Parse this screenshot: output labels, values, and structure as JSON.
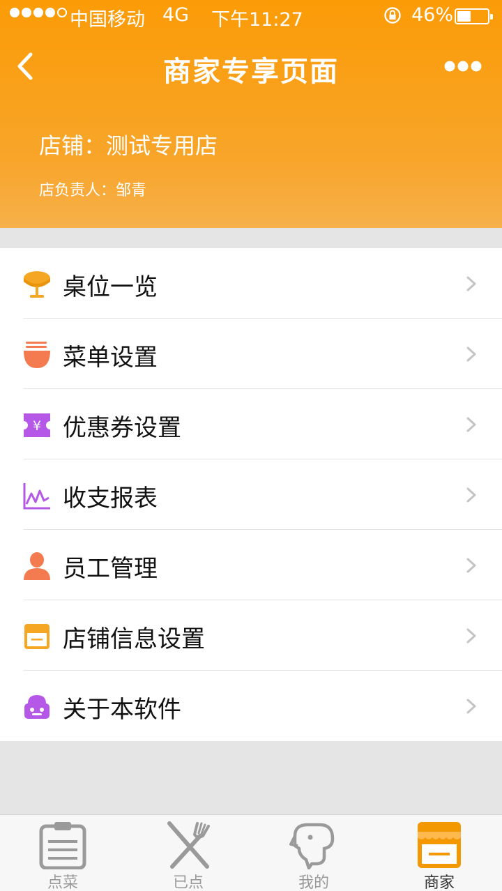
{
  "status_bar": {
    "carrier": "中国移动",
    "network": "4G",
    "time": "下午11:27",
    "battery_percent": "46%",
    "battery_level": 0.46
  },
  "nav": {
    "title": "商家专享页面",
    "back_icon": "chevron-left-icon",
    "more_icon": "ellipsis-icon"
  },
  "shop": {
    "name_line": "店铺：测试专用店",
    "owner_line": "店负责人：邹青"
  },
  "menu": [
    {
      "label": "桌位一览",
      "icon": "table-icon",
      "color": "#f5a623"
    },
    {
      "label": "菜单设置",
      "icon": "noodle-bowl-icon",
      "color": "#f47a50"
    },
    {
      "label": "优惠券设置",
      "icon": "coupon-icon",
      "color": "#b558e8"
    },
    {
      "label": "收支报表",
      "icon": "line-chart-icon",
      "color": "#b558e8"
    },
    {
      "label": "员工管理",
      "icon": "person-icon",
      "color": "#f47a50"
    },
    {
      "label": "店铺信息设置",
      "icon": "storefront-icon",
      "color": "#f5a623"
    },
    {
      "label": "关于本软件",
      "icon": "robot-icon",
      "color": "#b558e8"
    }
  ],
  "tabbar": [
    {
      "label": "点菜",
      "icon": "clipboard-icon",
      "active": false
    },
    {
      "label": "已点",
      "icon": "fork-knife-icon",
      "active": false
    },
    {
      "label": "我的",
      "icon": "dog-icon",
      "active": false
    },
    {
      "label": "商家",
      "icon": "shop-icon",
      "active": true
    }
  ],
  "colors": {
    "accent": "#fb9b06",
    "tab_active": "#f39800",
    "tab_inactive": "#9a9a9a"
  }
}
